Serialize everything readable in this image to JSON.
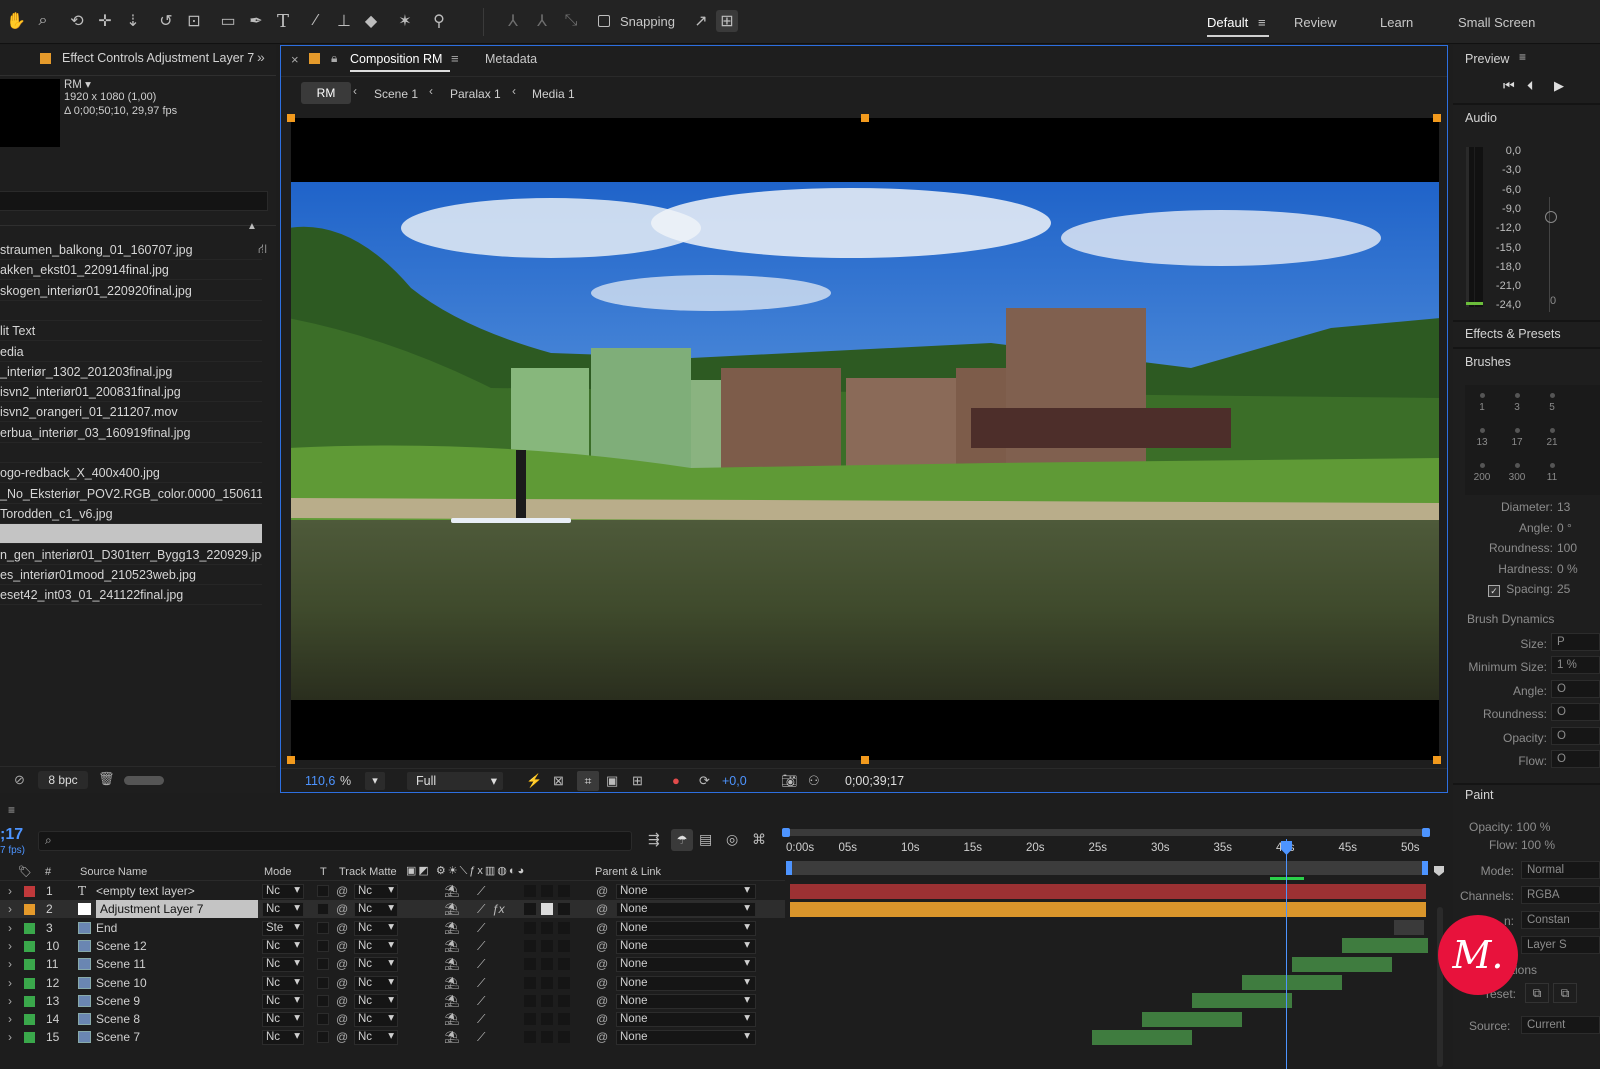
{
  "toolbar": {
    "snapping_label": "Snapping",
    "workspaces": [
      "Default",
      "Review",
      "Learn",
      "Small Screen"
    ],
    "active_workspace": "Default"
  },
  "effect_controls": {
    "tab_title": "Effect Controls Adjustment Layer 7",
    "comp_name": "RM ▾",
    "comp_size": "1920 x 1080 (1,00)",
    "comp_duration": "Δ 0;00;50;10, 29,97 fps"
  },
  "project": {
    "files": [
      "straumen_balkong_01_160707.jpg",
      "akken_ekst01_220914final.jpg",
      "skogen_interiør01_220920final.jpg",
      "",
      "lit Text",
      "edia",
      "_interiør_1302_201203final.jpg",
      "isvn2_interiør01_200831final.jpg",
      "isvn2_orangeri_01_211207.mov",
      "erbua_interiør_03_160919final.jpg",
      "",
      "ogo-redback_X_400x400.jpg",
      "_No_Eksteriør_POV2.RGB_color.0000_150611.jpg",
      "Torodden_c1_v6.jpg",
      "",
      "n_gen_interiør01_D301terr_Bygg13_220929.jpg",
      "es_interiør01mood_210523web.jpg",
      "eset42_int03_01_241122final.jpg"
    ],
    "bpc": "8 bpc"
  },
  "composition": {
    "tab_label": "Composition RM",
    "metadata_tab": "Metadata",
    "breadcrumbs": [
      "RM",
      "Scene 1",
      "Paralax 1",
      "Media 1"
    ],
    "zoom": "110,6",
    "zoom_unit": "%",
    "resolution": "Full",
    "exposure": "+0,0",
    "timecode": "0;00;39;17"
  },
  "preview": {
    "title": "Preview",
    "audio_title": "Audio",
    "db_scale": [
      "0,0",
      "-3,0",
      "-6,0",
      "-9,0",
      "-12,0",
      "-15,0",
      "-18,0",
      "-21,0",
      "-24,0"
    ],
    "db_right": "0",
    "effects_presets": "Effects & Presets",
    "brushes": "Brushes",
    "brush_sizes": [
      [
        "1",
        "3",
        "5"
      ],
      [
        "13",
        "17",
        "21"
      ],
      [
        "200",
        "300",
        "11"
      ]
    ],
    "brush_props": [
      {
        "label": "Diameter:",
        "value": "13"
      },
      {
        "label": "Angle:",
        "value": "0 °"
      },
      {
        "label": "Roundness:",
        "value": "100"
      },
      {
        "label": "Hardness:",
        "value": "0 %"
      },
      {
        "label": "Spacing:",
        "value": "25"
      }
    ],
    "brush_dynamics": "Brush Dynamics",
    "dynamics": [
      "Size:",
      "Minimum Size:",
      "Angle:",
      "Roundness:",
      "Opacity:",
      "Flow:"
    ],
    "dynamics_values": [
      "P",
      "1 %",
      "O",
      "O",
      "O",
      "O"
    ],
    "paint": "Paint",
    "paint_opacity": "Opacity:  100 %",
    "paint_flow": "Flow:  100 %",
    "paint_fields": [
      {
        "label": "Mode:",
        "value": "Normal"
      },
      {
        "label": "Channels:",
        "value": "RGBA"
      },
      {
        "label": "n:",
        "value": "Constan"
      },
      {
        "label": "",
        "value": "Layer S"
      }
    ],
    "options_label": "ptions",
    "preset_label": "reset:",
    "source_label": "Source:",
    "source_value": "Current"
  },
  "timeline": {
    "timecode": ";17",
    "fps": "7 fps)",
    "headers": {
      "hash": "#",
      "source": "Source Name",
      "mode": "Mode",
      "t": "T",
      "track_matte": "Track Matte",
      "parent": "Parent & Link"
    },
    "ruler": [
      "0:00s",
      "05s",
      "10s",
      "15s",
      "20s",
      "25s",
      "30s",
      "35s",
      "40s",
      "45s",
      "50s"
    ],
    "layers": [
      {
        "num": "1",
        "name": "<empty text layer>",
        "mode": "Nc",
        "matte": "Nc",
        "parent": "None",
        "color": "#c0393b"
      },
      {
        "num": "2",
        "name": "Adjustment Layer 7",
        "mode": "Nc",
        "matte": "Nc",
        "parent": "None",
        "color": "#e59a2b"
      },
      {
        "num": "3",
        "name": "End",
        "mode": "Ste",
        "matte": "Nc",
        "parent": "None",
        "color": "#3aa84b"
      },
      {
        "num": "10",
        "name": "Scene 12",
        "mode": "Nc",
        "matte": "Nc",
        "parent": "None",
        "color": "#3aa84b"
      },
      {
        "num": "11",
        "name": "Scene 11",
        "mode": "Nc",
        "matte": "Nc",
        "parent": "None",
        "color": "#3aa84b"
      },
      {
        "num": "12",
        "name": "Scene 10",
        "mode": "Nc",
        "matte": "Nc",
        "parent": "None",
        "color": "#3aa84b"
      },
      {
        "num": "13",
        "name": "Scene 9",
        "mode": "Nc",
        "matte": "Nc",
        "parent": "None",
        "color": "#3aa84b"
      },
      {
        "num": "14",
        "name": "Scene 8",
        "mode": "Nc",
        "matte": "Nc",
        "parent": "None",
        "color": "#3aa84b"
      },
      {
        "num": "15",
        "name": "Scene 7",
        "mode": "Nc",
        "matte": "Nc",
        "parent": "None",
        "color": "#3aa84b"
      }
    ]
  },
  "watermark": "M."
}
